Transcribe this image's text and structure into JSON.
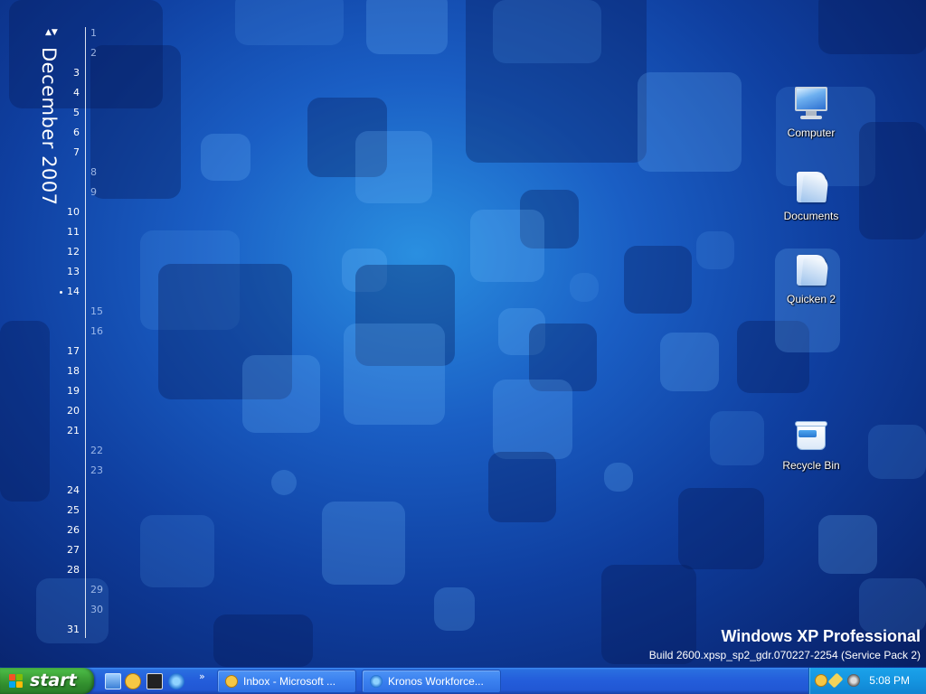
{
  "calendar": {
    "month_year": "December 2007",
    "arrows": "▲▼",
    "today": "14",
    "weekdays": [
      "3",
      "4",
      "5",
      "6",
      "7",
      "10",
      "11",
      "12",
      "13",
      "14",
      "17",
      "18",
      "19",
      "20",
      "21",
      "24",
      "25",
      "26",
      "27",
      "28",
      "31"
    ],
    "weekends": [
      "1",
      "2",
      "8",
      "9",
      "15",
      "16",
      "22",
      "23",
      "29",
      "30"
    ]
  },
  "desktop_icons": [
    {
      "label": "Computer",
      "icon": "computer-icon"
    },
    {
      "label": "Documents",
      "icon": "folder-icon"
    },
    {
      "label": "Quicken 2",
      "icon": "folder-icon"
    },
    {
      "label": "Recycle Bin",
      "icon": "recycle-bin-icon"
    }
  ],
  "os": {
    "name": "Windows XP Professional",
    "build": "Build 2600.xpsp_sp2_gdr.070227-2254 (Service Pack 2)"
  },
  "taskbar": {
    "start_label": "start",
    "quick_launch_more": "»",
    "windows": [
      {
        "label": "Inbox - Microsoft ...",
        "icon": "outlook-icon"
      },
      {
        "label": "Kronos Workforce...",
        "icon": "internet-explorer-icon"
      }
    ],
    "clock": "5:08 PM"
  },
  "colors": {
    "taskbar": "#245edb",
    "start": "#3c9f36",
    "tray": "#1595e0",
    "desktop": "#1a5ec4"
  }
}
